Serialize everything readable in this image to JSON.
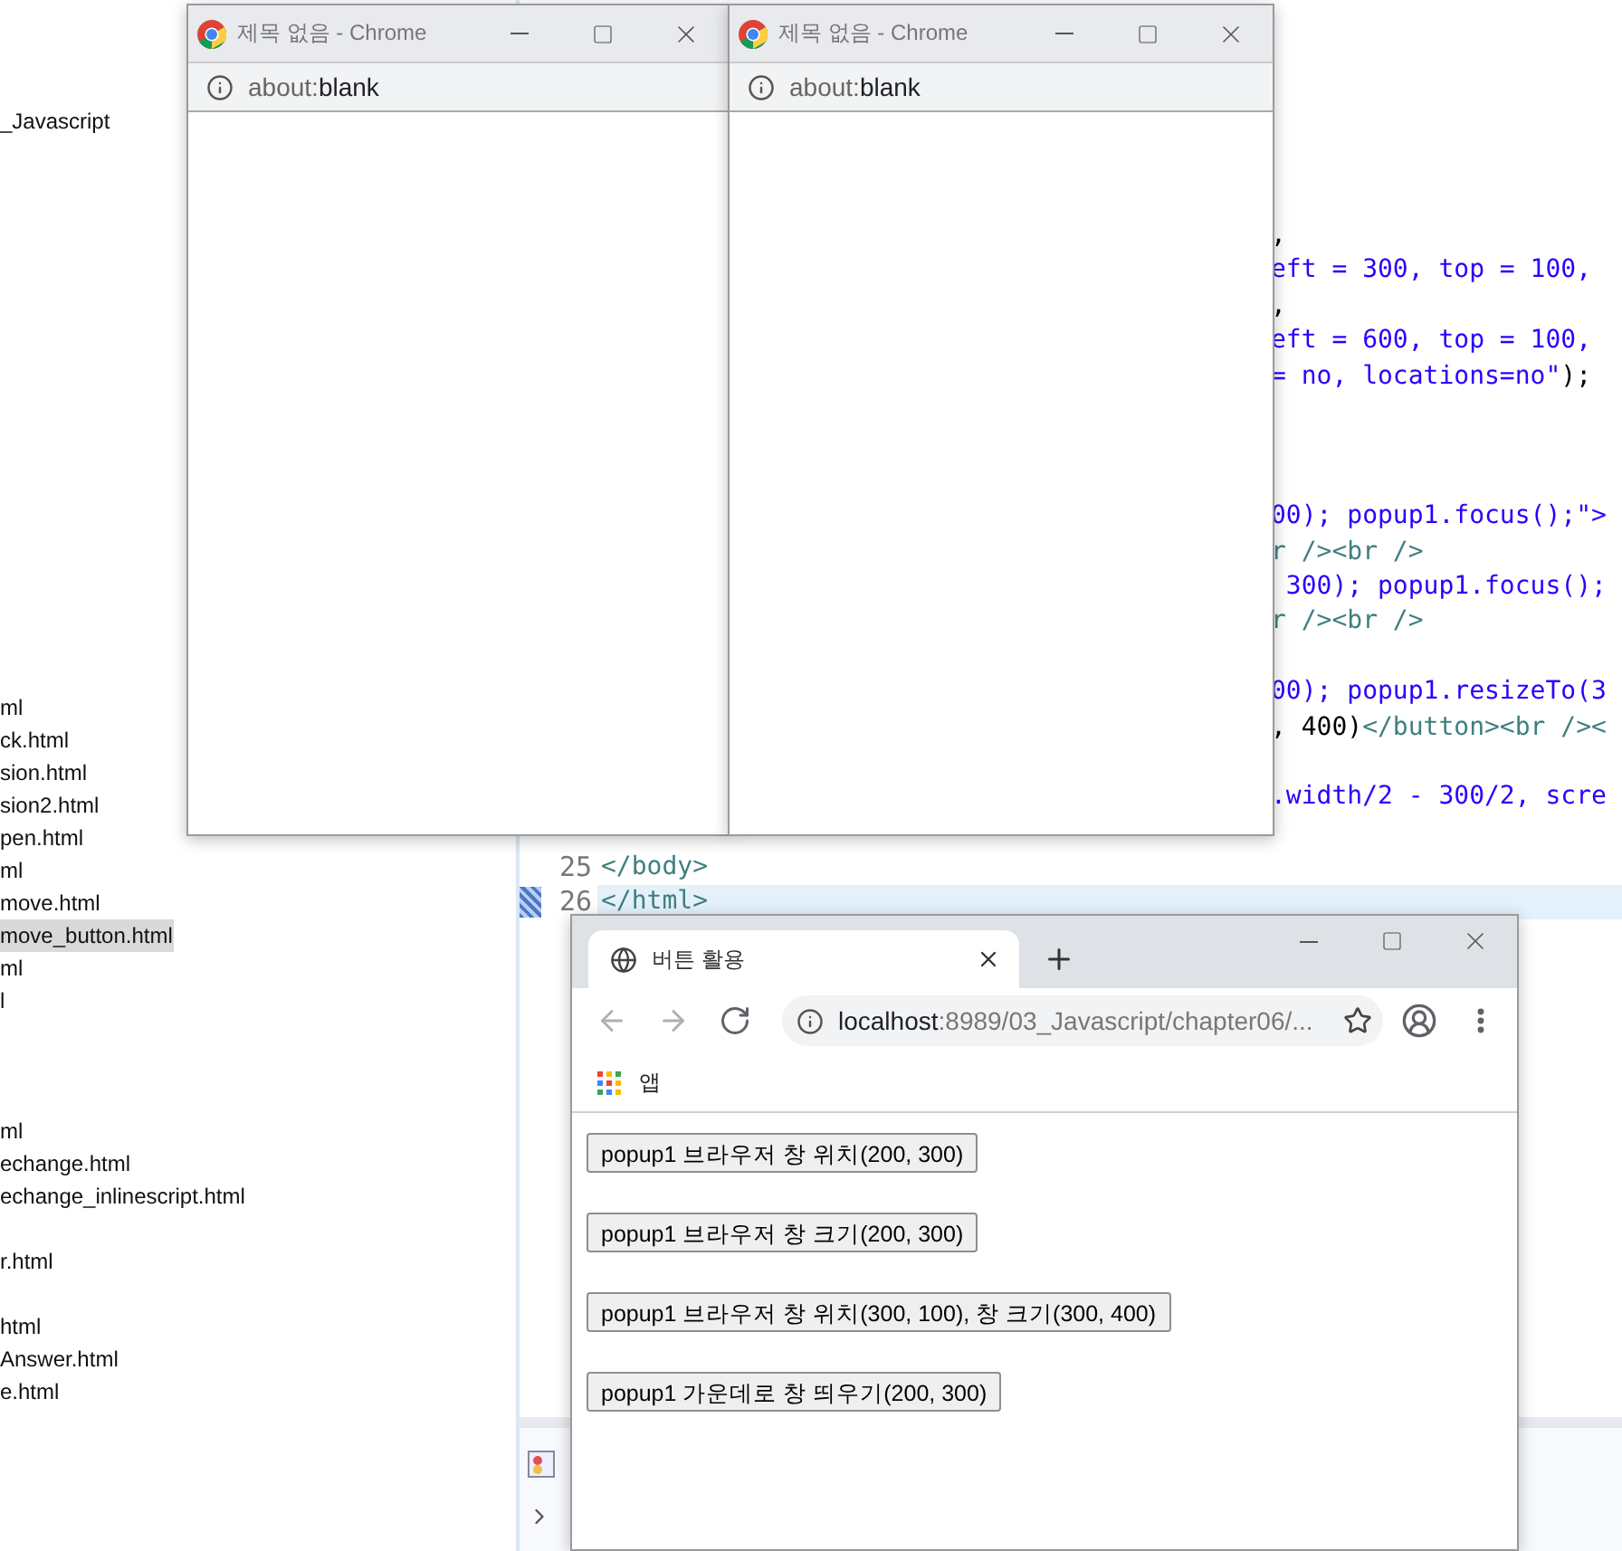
{
  "file_tree": [
    {
      "kind": "file",
      "label": "_Javascript",
      "selected": false
    },
    {
      "kind": "blank"
    },
    {
      "kind": "blank"
    },
    {
      "kind": "blank"
    },
    {
      "kind": "blank"
    },
    {
      "kind": "blank"
    },
    {
      "kind": "blank"
    },
    {
      "kind": "blank"
    },
    {
      "kind": "blank"
    },
    {
      "kind": "blank"
    },
    {
      "kind": "blank"
    },
    {
      "kind": "blank"
    },
    {
      "kind": "blank"
    },
    {
      "kind": "blank"
    },
    {
      "kind": "blank"
    },
    {
      "kind": "blank"
    },
    {
      "kind": "blank"
    },
    {
      "kind": "blank"
    },
    {
      "kind": "file",
      "label": "ml",
      "selected": false
    },
    {
      "kind": "file",
      "label": "ck.html",
      "selected": false
    },
    {
      "kind": "file",
      "label": "sion.html",
      "selected": false
    },
    {
      "kind": "file",
      "label": "sion2.html",
      "selected": false
    },
    {
      "kind": "file",
      "label": "pen.html",
      "selected": false
    },
    {
      "kind": "file",
      "label": "ml",
      "selected": false
    },
    {
      "kind": "file",
      "label": "move.html",
      "selected": false
    },
    {
      "kind": "file",
      "label": "move_button.html",
      "selected": true
    },
    {
      "kind": "file",
      "label": "ml",
      "selected": false
    },
    {
      "kind": "file",
      "label": "l",
      "selected": false
    },
    {
      "kind": "blank"
    },
    {
      "kind": "blank"
    },
    {
      "kind": "blank"
    },
    {
      "kind": "file",
      "label": "ml",
      "selected": false
    },
    {
      "kind": "file",
      "label": "echange.html",
      "selected": false
    },
    {
      "kind": "file",
      "label": "echange_inlinescript.html",
      "selected": false
    },
    {
      "kind": "blank"
    },
    {
      "kind": "file",
      "label": "r.html",
      "selected": false
    },
    {
      "kind": "blank"
    },
    {
      "kind": "file",
      "label": "html",
      "selected": false
    },
    {
      "kind": "file",
      "label": "Answer.html",
      "selected": false
    },
    {
      "kind": "file",
      "label": "e.html",
      "selected": false
    }
  ],
  "editor": {
    "lines": [
      {
        "kind": "blank"
      },
      {
        "kind": "blank"
      },
      {
        "kind": "blank"
      },
      {
        "kind": "blank"
      },
      {
        "kind": "blank"
      },
      {
        "kind": "blank"
      },
      {
        "kind": "clipped",
        "tokens": [
          {
            "kind": "plain",
            "text": ","
          }
        ]
      },
      {
        "kind": "clipped",
        "tokens": [
          {
            "kind": "string",
            "text": "eft = 300, top = 100,"
          }
        ]
      },
      {
        "kind": "clipped",
        "tokens": [
          {
            "kind": "plain",
            "text": ","
          }
        ]
      },
      {
        "kind": "clipped",
        "tokens": [
          {
            "kind": "string",
            "text": "eft = 600, top = 100,"
          }
        ]
      },
      {
        "kind": "clipped",
        "tokens": [
          {
            "kind": "string",
            "text": "= no, locations=no\""
          },
          {
            "kind": "plain",
            "text": ");"
          }
        ]
      },
      {
        "kind": "blank"
      },
      {
        "kind": "blank"
      },
      {
        "kind": "blank"
      },
      {
        "kind": "clipped",
        "tokens": [
          {
            "kind": "string",
            "text": "00); popup1.focus();\">"
          }
        ]
      },
      {
        "kind": "clipped",
        "tokens": [
          {
            "kind": "tag",
            "text": "r /><br />"
          }
        ]
      },
      {
        "kind": "clipped",
        "tokens": [
          {
            "kind": "string",
            "text": " 300); popup1.focus();"
          }
        ]
      },
      {
        "kind": "clipped",
        "tokens": [
          {
            "kind": "tag",
            "text": "r /><br />"
          }
        ]
      },
      {
        "kind": "blank"
      },
      {
        "kind": "clipped",
        "tokens": [
          {
            "kind": "string",
            "text": "00); popup1.resizeTo(3"
          }
        ]
      },
      {
        "kind": "clipped",
        "tokens": [
          {
            "kind": "plain",
            "text": ", 400)"
          },
          {
            "kind": "tag",
            "text": "</button><br /><"
          }
        ]
      },
      {
        "kind": "blank"
      },
      {
        "kind": "clipped",
        "tokens": [
          {
            "kind": "string",
            "text": ".width/2 - 300/2, scre"
          }
        ]
      },
      {
        "kind": "blank"
      },
      {
        "kind": "full",
        "number": "25",
        "current": false,
        "tokens": [
          {
            "kind": "tag",
            "text": "</body>"
          }
        ]
      },
      {
        "kind": "full",
        "number": "26",
        "current": true,
        "tokens": [
          {
            "kind": "tag",
            "text": "</html>"
          }
        ]
      }
    ]
  },
  "popups": [
    {
      "title": "제목 없음 - Chrome",
      "url_scheme": "about:",
      "url_rest": "blank"
    },
    {
      "title": "제목 없음 - Chrome",
      "url_scheme": "about:",
      "url_rest": "blank"
    }
  ],
  "browser": {
    "tabs": [
      {
        "title": "버튼 활용",
        "selected": true
      }
    ],
    "nav": [
      {
        "kind": "back",
        "disabled": true
      },
      {
        "kind": "forward",
        "disabled": true
      },
      {
        "kind": "reload",
        "disabled": false
      }
    ],
    "url_host": "localhost",
    "url_path": ":8989/03_Javascript/chapter06/...",
    "bookmarks": [
      {
        "label": "앱"
      }
    ],
    "buttons": [
      {
        "label": "popup1 브라우저 창 위치(200, 300)"
      },
      {
        "label": "popup1 브라우저 창 크기(200, 300)"
      },
      {
        "label": "popup1 브라우저 창 위치(300, 100), 창 크기(300, 400)"
      },
      {
        "label": "popup1 가운데로 창 띄우기(200, 300)"
      }
    ]
  }
}
